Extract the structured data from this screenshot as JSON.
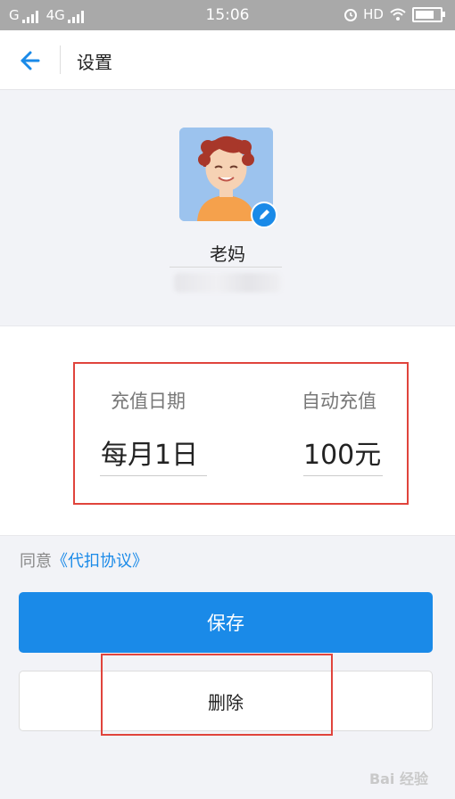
{
  "status_bar": {
    "carrier1": "G",
    "carrier2": "4G",
    "time": "15:06",
    "hd": "HD"
  },
  "nav": {
    "title": "设置"
  },
  "profile": {
    "name": "老妈"
  },
  "recharge": {
    "date_label": "充值日期",
    "date_value": "每月1日",
    "amount_label": "自动充值",
    "amount_value": "100元"
  },
  "agreement": {
    "prefix": "同意",
    "link": "《代扣协议》"
  },
  "buttons": {
    "save": "保存",
    "delete": "删除"
  },
  "watermark": "Bai 经验",
  "colors": {
    "accent": "#1a8ae8",
    "highlight": "#e0443c"
  }
}
